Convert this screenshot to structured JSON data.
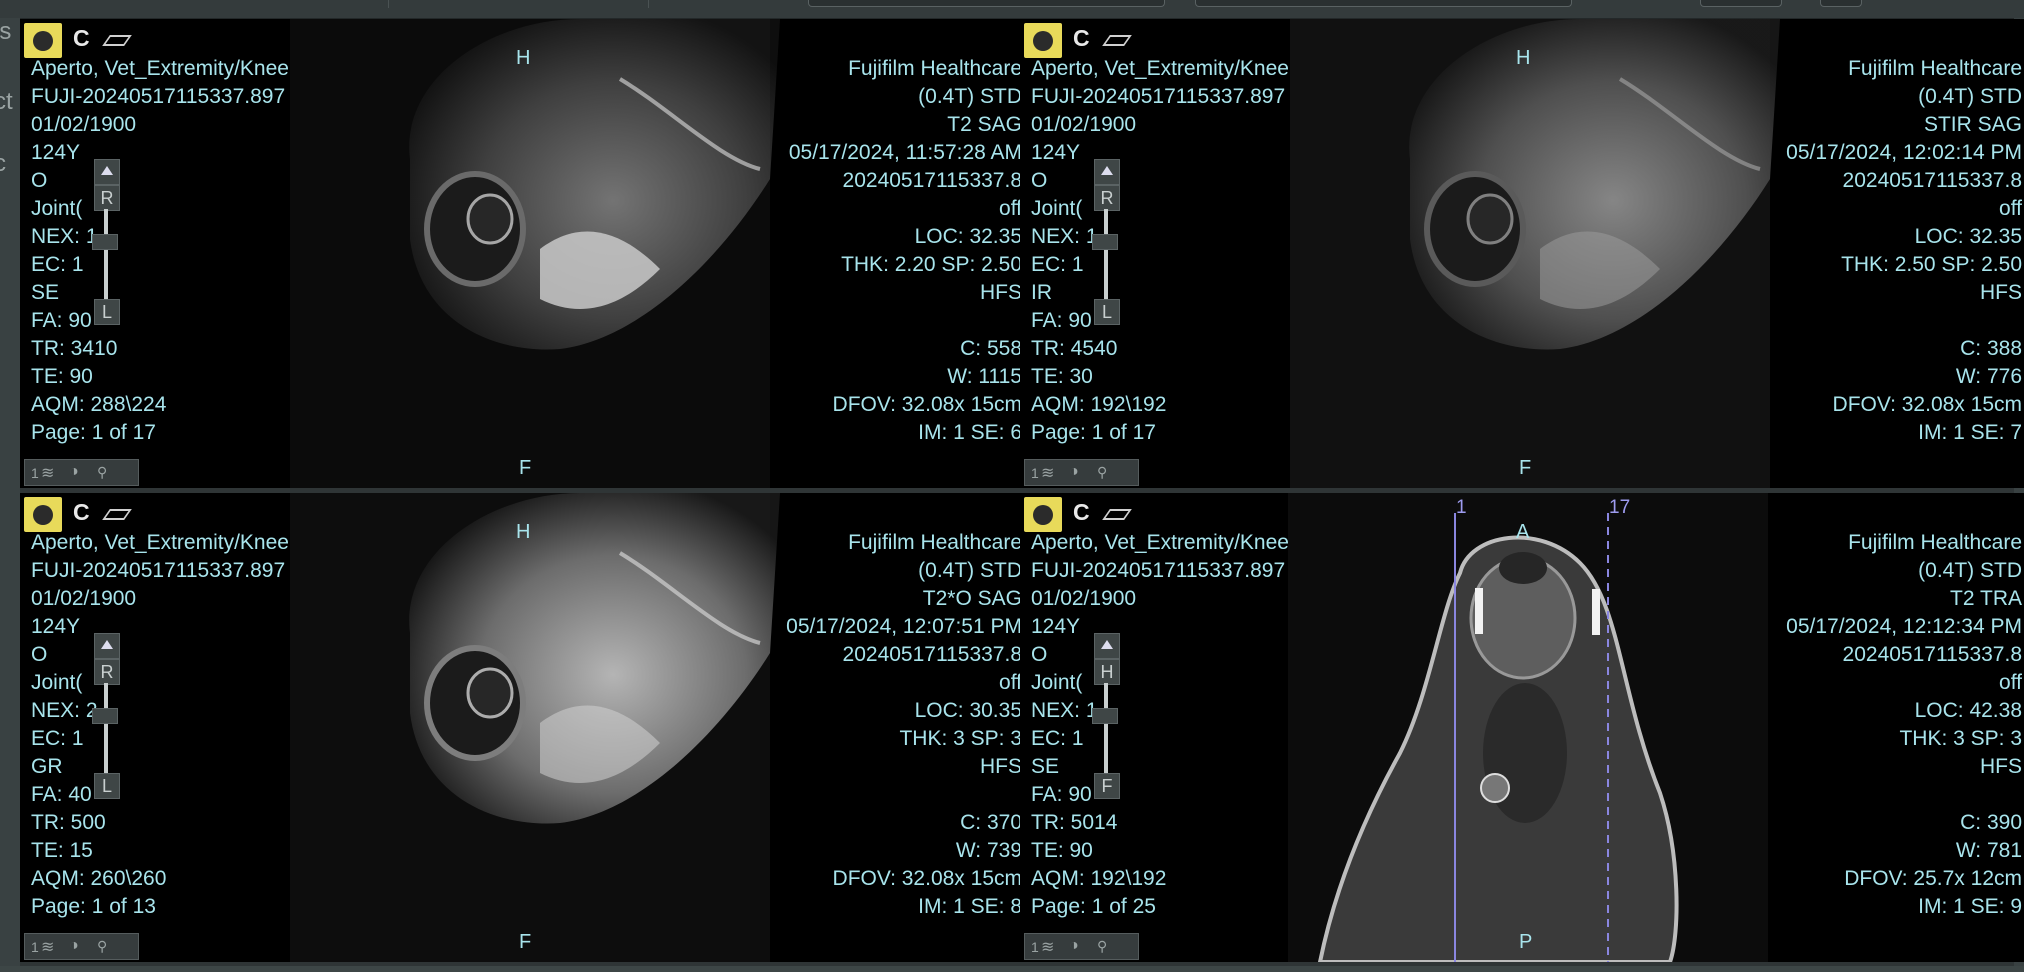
{
  "side_fragments": [
    "is",
    "ct",
    "c"
  ],
  "viewports": [
    {
      "id": "vp1",
      "header": "C",
      "left": [
        "Aperto, Vet_Extremity/Knee",
        "FUJI-20240517115337.897",
        "01/02/1900",
        "124Y",
        "O",
        "Joint(",
        "NEX: 1",
        "EC: 1",
        "SE",
        "FA: 90",
        "TR: 3410",
        "TE: 90",
        "AQM: 288\\224",
        "Page: 1 of 17"
      ],
      "right": [
        "Fujifilm Healthcare",
        "(0.4T) STD",
        "T2 SAG",
        "05/17/2024, 11:57:28 AM",
        "20240517115337.8",
        "off",
        "LOC: 32.35",
        "THK: 2.20 SP: 2.50",
        "HFS",
        "",
        "C: 558",
        "W: 1115",
        "DFOV: 32.08x 15cm",
        "IM: 1 SE: 6"
      ],
      "orient": {
        "top": "H",
        "bottom": "F"
      },
      "scale": {
        "up": "R",
        "down": "L"
      }
    },
    {
      "id": "vp2",
      "header": "C",
      "left": [
        "Aperto, Vet_Extremity/Knee",
        "FUJI-20240517115337.897",
        "01/02/1900",
        "124Y",
        "O",
        "Joint(",
        "NEX: 1",
        "EC: 1",
        "IR",
        "FA: 90",
        "TR: 4540",
        "TE: 30",
        "AQM: 192\\192",
        "Page: 1 of 17"
      ],
      "right": [
        "Fujifilm Healthcare",
        "(0.4T) STD",
        "STIR SAG",
        "05/17/2024, 12:02:14 PM",
        "20240517115337.8",
        "off",
        "LOC: 32.35",
        "THK: 2.50 SP: 2.50",
        "HFS",
        "",
        "C: 388",
        "W: 776",
        "DFOV: 32.08x 15cm",
        "IM: 1 SE: 7"
      ],
      "orient": {
        "top": "H",
        "bottom": "F"
      },
      "scale": {
        "up": "R",
        "down": "L"
      }
    },
    {
      "id": "vp3",
      "header": "C",
      "left": [
        "Aperto, Vet_Extremity/Knee",
        "FUJI-20240517115337.897",
        "01/02/1900",
        "124Y",
        "O",
        "Joint(",
        "NEX: 2",
        "EC: 1",
        "GR",
        "FA: 40",
        "TR: 500",
        "TE: 15",
        "AQM: 260\\260",
        "Page: 1 of 13"
      ],
      "right": [
        "Fujifilm Healthcare",
        "(0.4T) STD",
        "T2*O SAG",
        "05/17/2024, 12:07:51 PM",
        "20240517115337.8",
        "off",
        "LOC: 30.35",
        "THK: 3 SP: 3",
        "HFS",
        "",
        "C: 370",
        "W: 739",
        "DFOV: 32.08x 15cm",
        "IM: 1 SE: 8"
      ],
      "orient": {
        "top": "H",
        "bottom": "F"
      },
      "scale": {
        "up": "R",
        "down": "L"
      }
    },
    {
      "id": "vp4",
      "header": "C",
      "left": [
        "Aperto, Vet_Extremity/Knee",
        "FUJI-20240517115337.897",
        "01/02/1900",
        "124Y",
        "O",
        "Joint(",
        "NEX: 1",
        "EC: 1",
        "SE",
        "FA: 90",
        "TR: 5014",
        "TE: 90",
        "AQM: 192\\192",
        "Page: 1 of 25"
      ],
      "right": [
        "Fujifilm Healthcare",
        "(0.4T) STD",
        "T2 TRA",
        "05/17/2024, 12:12:34 PM",
        "20240517115337.8",
        "off",
        "LOC: 42.38",
        "THK: 3 SP: 3",
        "HFS",
        "",
        "C: 390",
        "W: 781",
        "DFOV: 25.7x 12cm",
        "IM: 1 SE: 9"
      ],
      "orient": {
        "top": "A",
        "bottom": "P"
      },
      "scale": {
        "up": "H",
        "down": "F"
      },
      "guides": {
        "first": "1",
        "last": "17"
      }
    }
  ],
  "tools_label": "1"
}
